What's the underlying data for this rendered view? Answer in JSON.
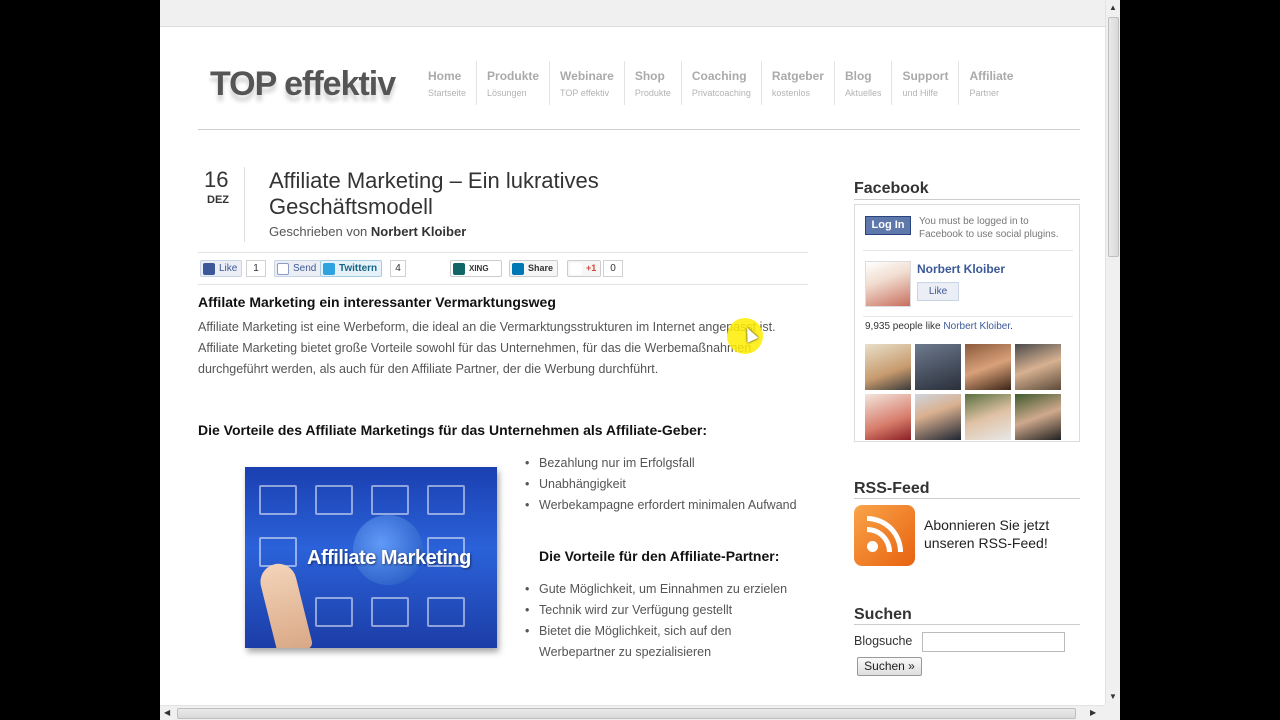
{
  "header": {
    "logo": "TOP effektiv",
    "nav": [
      {
        "title": "Home",
        "sub": "Startseite"
      },
      {
        "title": "Produkte",
        "sub": "Lösungen"
      },
      {
        "title": "Webinare",
        "sub": "TOP effektiv"
      },
      {
        "title": "Shop",
        "sub": "Produkte"
      },
      {
        "title": "Coaching",
        "sub": "Privatcoaching"
      },
      {
        "title": "Ratgeber",
        "sub": "kostenlos"
      },
      {
        "title": "Blog",
        "sub": "Aktuelles"
      },
      {
        "title": "Support",
        "sub": "und Hilfe"
      },
      {
        "title": "Affiliate",
        "sub": "Partner"
      }
    ]
  },
  "post": {
    "date_day": "16",
    "date_month": "DEZ",
    "title": "Affiliate Marketing – Ein lukratives Geschäftsmodell",
    "byline_prefix": "Geschrieben von ",
    "author": "Norbert Kloiber",
    "social": {
      "like_label": "Like",
      "like_count": "1",
      "send_label": "Send",
      "twitter_label": "Twittern",
      "twitter_count": "4",
      "xing_label": "XING",
      "share_label": "Share",
      "gplus_label": "+1",
      "gplus_count": "0"
    },
    "subheading1": "Affilate Marketing ein interessanter Vermarktungsweg",
    "paragraph": "Affiliate Marketing ist eine Werbeform, die ideal an die Vermarktungsstrukturen im Internet angepasst ist. Affiliate Marketing bietet große Vorteile sowohl für das Unternehmen, für das die Werbemaßnahmen durchgeführt werden, als auch für den Affiliate Partner, der die Werbung durchführt.",
    "subheading2": "Die Vorteile des Affiliate Marketings für das Unternehmen als Affiliate-Geber:",
    "image_label": "Affiliate Marketing",
    "list1": [
      "Bezahlung nur im Erfolgsfall",
      "Unabhängigkeit",
      "Werbekampagne erfordert minimalen Aufwand"
    ],
    "subheading3": "Die Vorteile für den Affiliate-Partner:",
    "list2": [
      "Gute Möglichkeit, um Einnahmen zu erzielen",
      "Technik wird zur Verfügung gestellt",
      "Bietet die Möglichkeit, sich auf den Werbepartner zu spezialisieren"
    ]
  },
  "sidebar": {
    "facebook": {
      "heading": "Facebook",
      "login_label": "Log In",
      "login_msg": "You must be logged in to Facebook to use social plugins.",
      "page_name": "Norbert Kloiber",
      "like_label": "Like",
      "count_prefix": "9,935 people like ",
      "count_name": "Norbert Kloiber",
      "count_suffix": "."
    },
    "rss": {
      "heading": "RSS-Feed",
      "text": "Abonnieren Sie jetzt unseren RSS-Feed!"
    },
    "search": {
      "heading": "Suchen",
      "label": "Blogsuche",
      "input_value": "",
      "button_label": "Suchen »"
    }
  },
  "colors": {
    "link": "#3b5998",
    "rss": "#e8620f",
    "highlight": "#ffec00"
  }
}
